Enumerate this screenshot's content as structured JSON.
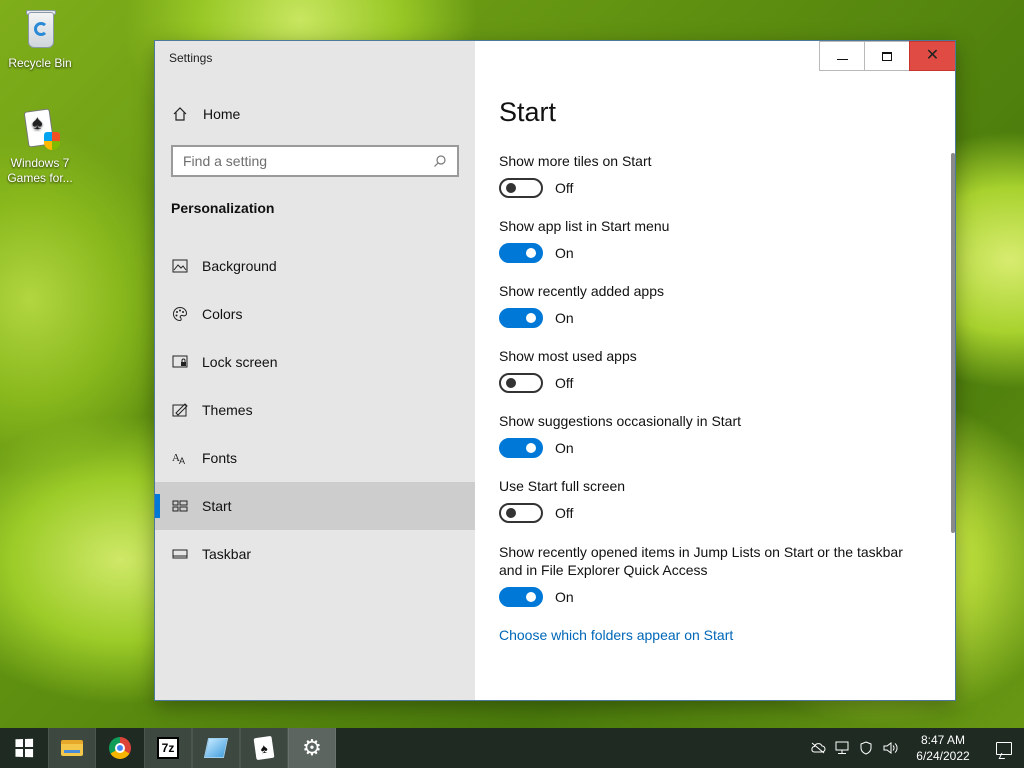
{
  "desktop": {
    "icons": [
      {
        "label": "Recycle Bin",
        "icon": "recycle-bin-icon"
      },
      {
        "label": "Windows 7 Games for...",
        "icon": "solitaire-icon"
      }
    ]
  },
  "window": {
    "title": "Settings",
    "controls": {
      "minimize": "minimize",
      "maximize": "maximize",
      "close": "close"
    }
  },
  "sidebar": {
    "home_label": "Home",
    "search_placeholder": "Find a setting",
    "section": "Personalization",
    "items": [
      {
        "label": "Background",
        "icon": "image-icon",
        "active": false
      },
      {
        "label": "Colors",
        "icon": "palette-icon",
        "active": false
      },
      {
        "label": "Lock screen",
        "icon": "lock-screen-icon",
        "active": false
      },
      {
        "label": "Themes",
        "icon": "themes-icon",
        "active": false
      },
      {
        "label": "Fonts",
        "icon": "fonts-icon",
        "active": false
      },
      {
        "label": "Start",
        "icon": "start-tiles-icon",
        "active": true
      },
      {
        "label": "Taskbar",
        "icon": "taskbar-icon",
        "active": false
      }
    ]
  },
  "content": {
    "title": "Start",
    "settings": [
      {
        "label": "Show more tiles on Start",
        "state": "Off",
        "on": false
      },
      {
        "label": "Show app list in Start menu",
        "state": "On",
        "on": true
      },
      {
        "label": "Show recently added apps",
        "state": "On",
        "on": true
      },
      {
        "label": "Show most used apps",
        "state": "Off",
        "on": false
      },
      {
        "label": "Show suggestions occasionally in Start",
        "state": "On",
        "on": true
      },
      {
        "label": "Use Start full screen",
        "state": "Off",
        "on": false
      },
      {
        "label": "Show recently opened items in Jump Lists on Start or the taskbar and in File Explorer Quick Access",
        "state": "On",
        "on": true
      }
    ],
    "link": "Choose which folders appear on Start"
  },
  "taskbar": {
    "apps": [
      {
        "name": "file-explorer",
        "active": false
      },
      {
        "name": "chrome",
        "active": false
      },
      {
        "name": "7zip",
        "active": false
      },
      {
        "name": "glass-app",
        "active": false
      },
      {
        "name": "solitaire",
        "active": false
      },
      {
        "name": "settings",
        "active": true
      }
    ],
    "clock": {
      "time": "8:47 AM",
      "date": "6/24/2022"
    },
    "colors": {
      "background": "#1e2a22",
      "accent": "#0078d7"
    }
  }
}
